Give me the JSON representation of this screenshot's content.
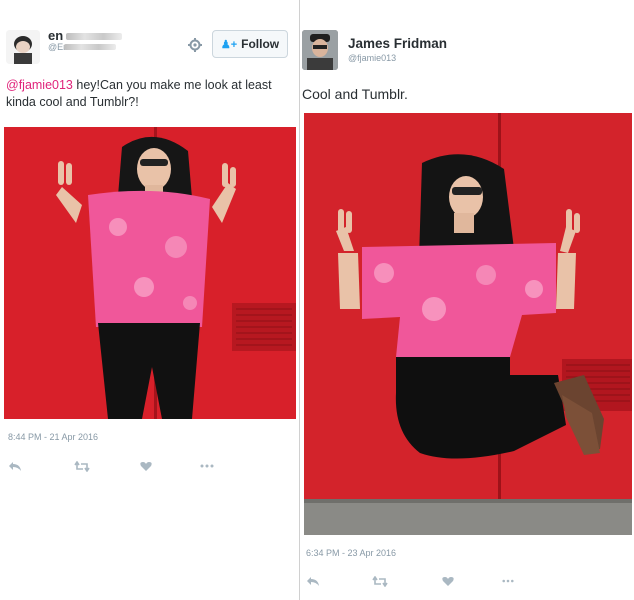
{
  "left_tweet": {
    "user": {
      "name": "en",
      "handle": "@En"
    },
    "follow_label": "Follow",
    "text_mention": "@fjamie013",
    "text_body": " hey!Can you make me look at least kinda cool and Tumblr?!",
    "timestamp": "8:44 PM - 21 Apr 2016",
    "actions": [
      "reply-icon",
      "retweet-icon",
      "like-icon",
      "more-icon"
    ]
  },
  "right_tweet": {
    "user": {
      "name": "James Fridman",
      "handle": "@fjamie013"
    },
    "text": "Cool and Tumblr.",
    "timestamp": "6:34 PM - 23 Apr 2016",
    "actions": [
      "reply-icon",
      "retweet-icon",
      "like-icon",
      "more-icon"
    ]
  },
  "colors": {
    "mention": "#e0247b",
    "follow_accent": "#1da1f2",
    "photo_wall": "#d8202a",
    "shirt": "#f0579a"
  }
}
